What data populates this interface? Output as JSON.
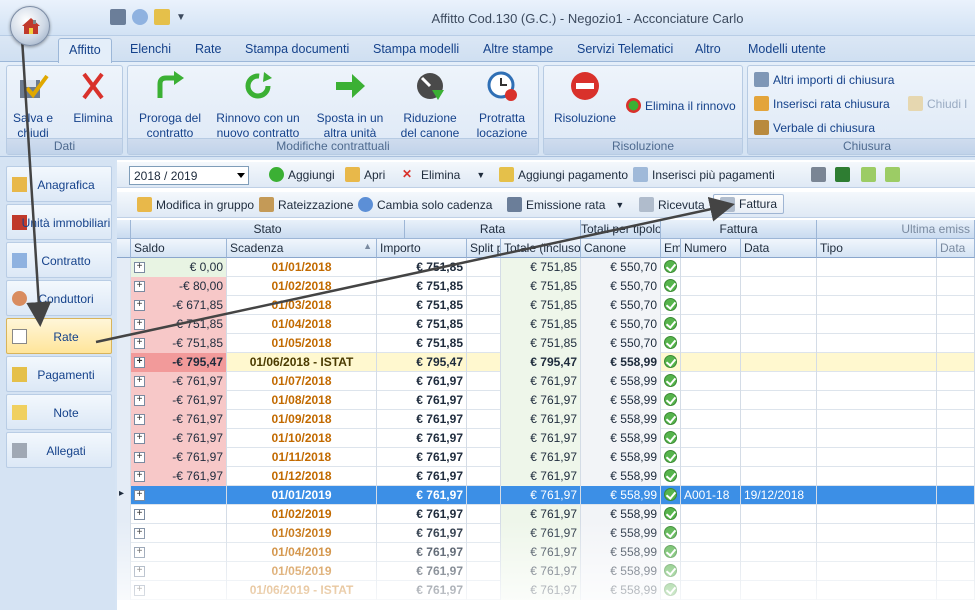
{
  "window": {
    "title": "Affitto Cod.130 (G.C.) - Negozio1 - Acconciature Carlo"
  },
  "tabs": [
    "Affitto",
    "Elenchi",
    "Rate",
    "Stampa documenti",
    "Stampa modelli",
    "Altre stampe",
    "Servizi Telematici",
    "Altro",
    "Modelli utente"
  ],
  "ribbon": {
    "dati": {
      "label": "Dati",
      "salva": "Salva e chiudi",
      "elimina": "Elimina"
    },
    "modifiche": {
      "label": "Modifiche contrattuali",
      "proroga": "Proroga del contratto",
      "rinnovo": "Rinnovo con un nuovo contratto",
      "sposta": "Sposta in un altra unità",
      "riduzione": "Riduzione del canone",
      "protratta": "Protratta locazione"
    },
    "risoluzione": {
      "label": "Risoluzione",
      "risoluzione": "Risoluzione",
      "elimina_rinnovo": "Elimina il rinnovo"
    },
    "chiusura": {
      "label": "Chiusura",
      "altri": "Altri importi di chiusura",
      "inserisci": "Inserisci rata chiusura",
      "verbale": "Verbale di chiusura",
      "chiudi": "Chiudi l"
    }
  },
  "nav": [
    "Anagrafica",
    "Unità immobiliari",
    "Contratto",
    "Conduttori",
    "Rate",
    "Pagamenti",
    "Note",
    "Allegati"
  ],
  "toolbar1": {
    "year": "2018 / 2019",
    "aggiungi": "Aggiungi",
    "apri": "Apri",
    "elimina": "Elimina",
    "aggiungi_pagamento": "Aggiungi pagamento",
    "inserisci_piu": "Inserisci più pagamenti"
  },
  "toolbar2": {
    "modifica": "Modifica in gruppo",
    "rateizzazione": "Rateizzazione",
    "cambia": "Cambia solo cadenza",
    "emissione": "Emissione rata",
    "ricevuta": "Ricevuta",
    "fattura": "Fattura"
  },
  "grid": {
    "bands": {
      "stato": "Stato",
      "rata": "Rata",
      "totali": "Totali per tipolo",
      "fattura": "Fattura",
      "ultima": "Ultima emiss"
    },
    "cols": {
      "saldo": "Saldo",
      "scadenza": "Scadenza",
      "importo": "Importo",
      "split": "Split p",
      "totale": "Totale (incluso i",
      "canone": "Canone",
      "em": "Em",
      "numero": "Numero",
      "data": "Data",
      "tipo": "Tipo",
      "data2": "Data"
    },
    "rows": [
      {
        "saldo": "€ 0,00",
        "scadenza": "01/01/2018",
        "importo": "€ 751,85",
        "totale": "€ 751,85",
        "canone": "€ 550,70",
        "numero": "",
        "data": ""
      },
      {
        "saldo": "-€ 80,00",
        "scadenza": "01/02/2018",
        "importo": "€ 751,85",
        "totale": "€ 751,85",
        "canone": "€ 550,70",
        "numero": "",
        "data": ""
      },
      {
        "saldo": "-€ 671,85",
        "scadenza": "01/03/2018",
        "importo": "€ 751,85",
        "totale": "€ 751,85",
        "canone": "€ 550,70",
        "numero": "",
        "data": ""
      },
      {
        "saldo": "-€ 751,85",
        "scadenza": "01/04/2018",
        "importo": "€ 751,85",
        "totale": "€ 751,85",
        "canone": "€ 550,70",
        "numero": "",
        "data": ""
      },
      {
        "saldo": "-€ 751,85",
        "scadenza": "01/05/2018",
        "importo": "€ 751,85",
        "totale": "€ 751,85",
        "canone": "€ 550,70",
        "numero": "",
        "data": ""
      },
      {
        "saldo": "-€ 795,47",
        "scadenza": "01/06/2018 - ISTAT",
        "importo": "€ 795,47",
        "totale": "€ 795,47",
        "canone": "€ 558,99",
        "numero": "",
        "data": ""
      },
      {
        "saldo": "-€ 761,97",
        "scadenza": "01/07/2018",
        "importo": "€ 761,97",
        "totale": "€ 761,97",
        "canone": "€ 558,99",
        "numero": "",
        "data": ""
      },
      {
        "saldo": "-€ 761,97",
        "scadenza": "01/08/2018",
        "importo": "€ 761,97",
        "totale": "€ 761,97",
        "canone": "€ 558,99",
        "numero": "",
        "data": ""
      },
      {
        "saldo": "-€ 761,97",
        "scadenza": "01/09/2018",
        "importo": "€ 761,97",
        "totale": "€ 761,97",
        "canone": "€ 558,99",
        "numero": "",
        "data": ""
      },
      {
        "saldo": "-€ 761,97",
        "scadenza": "01/10/2018",
        "importo": "€ 761,97",
        "totale": "€ 761,97",
        "canone": "€ 558,99",
        "numero": "",
        "data": ""
      },
      {
        "saldo": "-€ 761,97",
        "scadenza": "01/11/2018",
        "importo": "€ 761,97",
        "totale": "€ 761,97",
        "canone": "€ 558,99",
        "numero": "",
        "data": ""
      },
      {
        "saldo": "-€ 761,97",
        "scadenza": "01/12/2018",
        "importo": "€ 761,97",
        "totale": "€ 761,97",
        "canone": "€ 558,99",
        "numero": "",
        "data": ""
      },
      {
        "saldo": "",
        "scadenza": "01/01/2019",
        "importo": "€ 761,97",
        "totale": "€ 761,97",
        "canone": "€ 558,99",
        "numero": "A001-18",
        "data": "19/12/2018"
      },
      {
        "saldo": "",
        "scadenza": "01/02/2019",
        "importo": "€ 761,97",
        "totale": "€ 761,97",
        "canone": "€ 558,99",
        "numero": "",
        "data": ""
      },
      {
        "saldo": "",
        "scadenza": "01/03/2019",
        "importo": "€ 761,97",
        "totale": "€ 761,97",
        "canone": "€ 558,99",
        "numero": "",
        "data": ""
      },
      {
        "saldo": "",
        "scadenza": "01/04/2019",
        "importo": "€ 761,97",
        "totale": "€ 761,97",
        "canone": "€ 558,99",
        "numero": "",
        "data": ""
      },
      {
        "saldo": "",
        "scadenza": "01/05/2019",
        "importo": "€ 761,97",
        "totale": "€ 761,97",
        "canone": "€ 558,99",
        "numero": "",
        "data": ""
      },
      {
        "saldo": "",
        "scadenza": "01/06/2019 - ISTAT",
        "importo": "€ 761,97",
        "totale": "€ 761,97",
        "canone": "€ 558,99",
        "numero": "",
        "data": ""
      }
    ]
  }
}
